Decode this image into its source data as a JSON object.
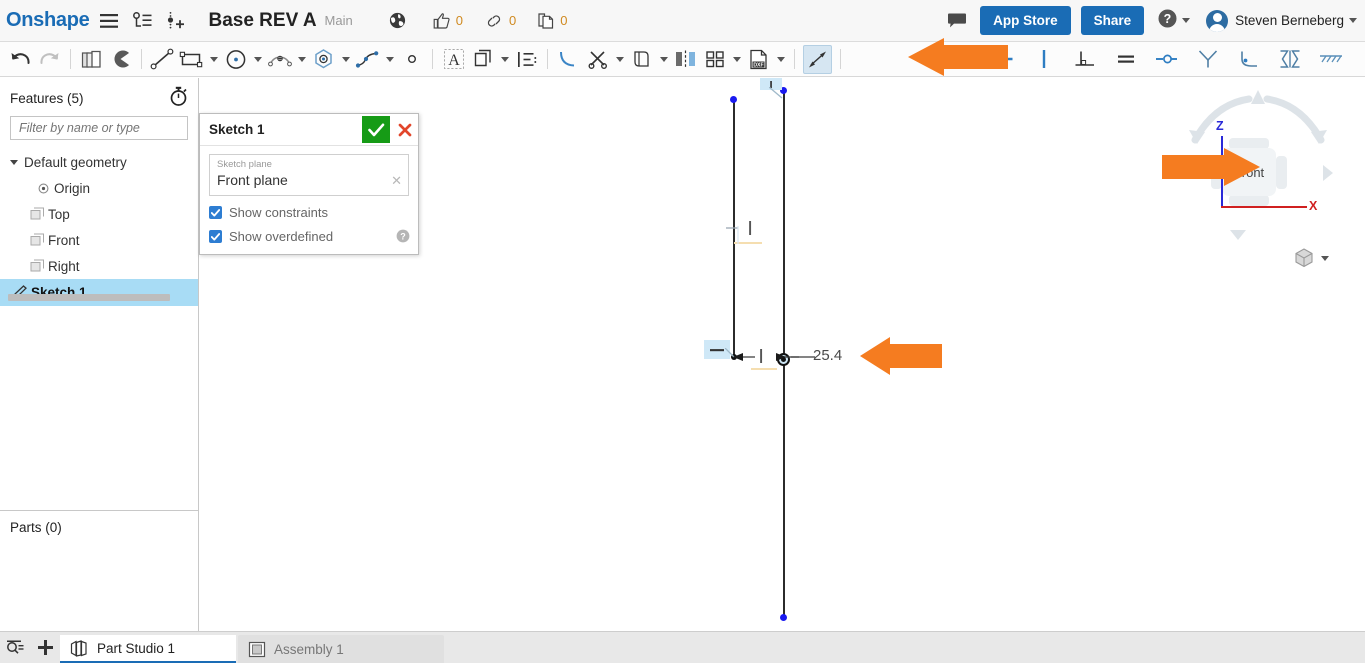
{
  "header": {
    "logo": "Onshape",
    "menu_icon": "hamburger-menu-icon",
    "versions_icon": "version-graph-icon",
    "insert_icon": "insert-feature-icon",
    "document_title": "Base REV A",
    "workspace": "Main",
    "globe_icon": "globe-icon",
    "like_count": "0",
    "link_count": "0",
    "copy_count": "0",
    "comment_icon": "comment-icon",
    "app_store_label": "App Store",
    "share_label": "Share",
    "help_icon": "help-circle-icon",
    "user_name": "Steven Berneberg"
  },
  "toolbar": {
    "groups": [
      {
        "items": [
          {
            "name": "undo-button",
            "icon": "undo-arrow-icon",
            "disabled": false
          },
          {
            "name": "redo-button",
            "icon": "redo-arrow-icon",
            "disabled": true
          }
        ]
      },
      {
        "items": [
          {
            "name": "sketch-copy-button",
            "icon": "copy-sketch-icon",
            "disabled": false
          },
          {
            "name": "sketch-shaded-button",
            "icon": "pac-shape-icon",
            "disabled": false
          }
        ]
      },
      {
        "items": [
          {
            "name": "line-tool",
            "icon": "line-icon",
            "disabled": false
          },
          {
            "name": "rectangle-tool",
            "icon": "rectangle-icon",
            "caret": true
          },
          {
            "name": "circle-tool",
            "icon": "circle-icon",
            "caret": true
          },
          {
            "name": "arc-tool",
            "icon": "arc-icon",
            "caret": true
          },
          {
            "name": "polygon-tool",
            "icon": "polygon-icon",
            "caret": true
          },
          {
            "name": "spline-tool",
            "icon": "spline-icon",
            "caret": true
          },
          {
            "name": "point-tool",
            "icon": "point-icon",
            "disabled": false
          }
        ]
      },
      {
        "items": [
          {
            "name": "text-tool",
            "icon": "text-icon",
            "disabled": false
          },
          {
            "name": "offset-tool",
            "icon": "offset-icon",
            "caret": true
          },
          {
            "name": "sketch-list-tool",
            "icon": "list-icon",
            "disabled": false
          }
        ]
      },
      {
        "items": [
          {
            "name": "fillet-tool",
            "icon": "fillet-icon",
            "disabled": false
          },
          {
            "name": "trim-tool",
            "icon": "scissors-icon",
            "caret": true
          },
          {
            "name": "extend-tool",
            "icon": "extend-icon",
            "caret": true
          },
          {
            "name": "mirror-tool",
            "icon": "mirror-icon",
            "disabled": false
          },
          {
            "name": "pattern-tool",
            "icon": "pattern-grid-icon",
            "caret": true
          },
          {
            "name": "import-dxf-tool",
            "icon": "dxf-file-icon",
            "caret": true
          }
        ]
      },
      {
        "items": [
          {
            "name": "dimension-tool",
            "icon": "dimension-arrow-icon",
            "active": true
          }
        ]
      },
      {
        "items": [
          {
            "name": "construction-tool",
            "icon": "construction-line-icon",
            "disabled": false
          },
          {
            "name": "horizontal-constraint",
            "icon": "horizontal-icon",
            "disabled": false
          },
          {
            "name": "vertical-constraint",
            "icon": "vertical-icon",
            "disabled": false
          },
          {
            "name": "perpendicular-constraint",
            "icon": "perpendicular-icon",
            "disabled": false
          },
          {
            "name": "equal-constraint",
            "icon": "equal-icon",
            "disabled": false
          },
          {
            "name": "concentric-constraint",
            "icon": "concentric-icon",
            "disabled": false
          },
          {
            "name": "tangent-constraint",
            "icon": "tangent-icon",
            "disabled": false
          },
          {
            "name": "midpoint-constraint",
            "icon": "midpoint-icon",
            "disabled": false
          },
          {
            "name": "symmetric-constraint",
            "icon": "symmetric-icon",
            "disabled": false
          },
          {
            "name": "fix-constraint",
            "icon": "fix-hatch-icon",
            "disabled": false
          }
        ]
      }
    ]
  },
  "sidebar": {
    "features_title": "Features (5)",
    "timer_icon": "stopwatch-icon",
    "filter_placeholder": "Filter by name or type",
    "filter_value": "",
    "tree": [
      {
        "label": "Default geometry",
        "icon": "chevron-down-icon",
        "level": 0,
        "selected": false
      },
      {
        "label": "Origin",
        "icon": "origin-icon",
        "level": 1,
        "selected": false
      },
      {
        "label": "Top",
        "icon": "plane-icon",
        "level": 1,
        "selected": false
      },
      {
        "label": "Front",
        "icon": "plane-icon",
        "level": 1,
        "selected": false
      },
      {
        "label": "Right",
        "icon": "plane-icon",
        "level": 1,
        "selected": false
      },
      {
        "label": "Sketch 1",
        "icon": "sketch-icon",
        "level": 0,
        "selected": true
      }
    ],
    "parts_title": "Parts (0)"
  },
  "sketch_dialog": {
    "title": "Sketch 1",
    "accept_icon": "check-icon",
    "cancel_icon": "x-icon",
    "plane_field_label": "Sketch plane",
    "plane_field_value": "Front plane",
    "clear_icon": "clear-x-icon",
    "show_constraints_label": "Show constraints",
    "show_constraints_checked": true,
    "show_overdefined_label": "Show overdefined",
    "show_overdefined_checked": true,
    "help_icon": "help-icon"
  },
  "canvas": {
    "dimension_value": "25.4",
    "vertical_constraint_glyph": "|",
    "horizontal_constraint_glyph": "—",
    "origin_marker": "origin-point-icon"
  },
  "viewcube": {
    "face_label": "Front",
    "z_axis_label": "Z",
    "x_axis_label": "X",
    "z_axis_color": "#2a2ad8",
    "x_axis_color": "#d02020",
    "view_mode_icon": "cube-display-icon"
  },
  "annotations": {
    "arrow_color": "#f57c20",
    "arrows": [
      {
        "name": "arrow-to-dimension-tool",
        "points": "left"
      },
      {
        "name": "arrow-to-viewcube-front",
        "points": "right"
      },
      {
        "name": "arrow-to-dimension-value",
        "points": "left"
      }
    ]
  },
  "tabbar": {
    "search_icon": "search-tabs-icon",
    "add_icon": "plus-icon",
    "tabs": [
      {
        "label": "Part Studio 1",
        "icon": "part-studio-icon",
        "active": true
      },
      {
        "label": "Assembly 1",
        "icon": "assembly-icon",
        "active": false
      }
    ]
  }
}
